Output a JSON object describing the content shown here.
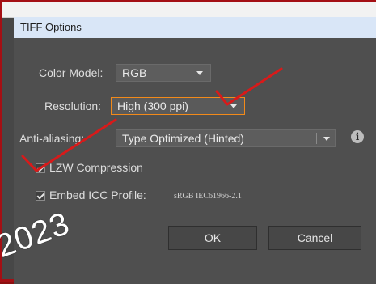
{
  "dialog": {
    "title": "TIFF Options",
    "color_model": {
      "label": "Color Model:",
      "value": "RGB"
    },
    "resolution": {
      "label": "Resolution:",
      "value": "High (300 ppi)"
    },
    "anti_aliasing": {
      "label": "Anti-aliasing:",
      "value": "Type Optimized (Hinted)"
    },
    "lzw": {
      "label": "LZW Compression",
      "checked": true
    },
    "embed_icc": {
      "label": "Embed ICC Profile:",
      "profile": "sRGB IEC61966-2.1",
      "checked": true
    },
    "buttons": {
      "ok": "OK",
      "cancel": "Cancel"
    }
  },
  "annotations": {
    "year": "2023"
  },
  "colors": {
    "frame": "#a40f14",
    "focus": "#f28a1a",
    "annotation_red": "#d81a1a"
  },
  "icons": {
    "dropdown": "chevron-down-icon",
    "info": "info-icon",
    "check": "check-icon"
  }
}
